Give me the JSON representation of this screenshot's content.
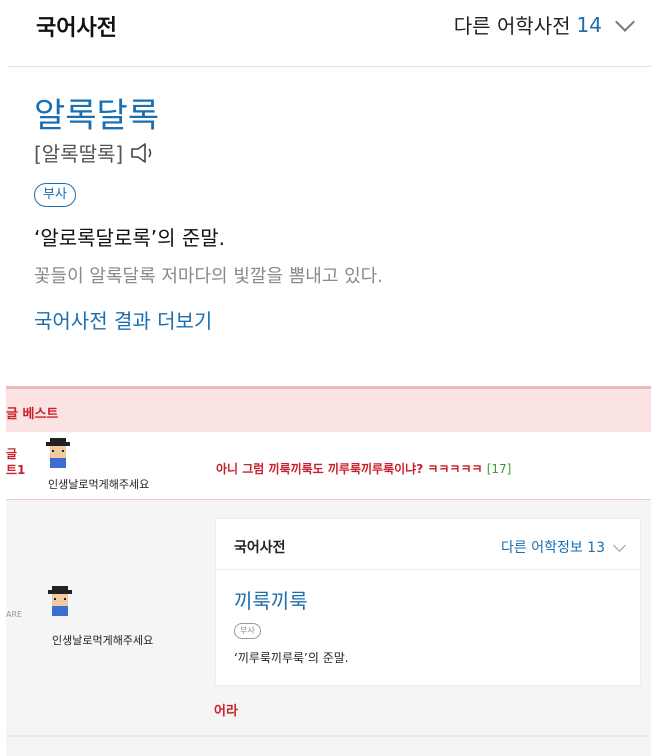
{
  "top": {
    "title": "국어사전",
    "other_label": "다른 어학사전",
    "other_count": "14",
    "headword": "알록달록",
    "pronunciation": "[알록딸록]",
    "pos": "부사",
    "definition": "‘알로록달로록’의 준말.",
    "example": "꽃들이 알록달록 저마다의 빛깔을 뽐내고 있다.",
    "more_link": "국어사전 결과 더보기"
  },
  "lower": {
    "best_label": "글 베스트",
    "row1": {
      "rank": "글\n트1",
      "username": "인생날로먹게해주세요",
      "comment": "아니 그럼 끼룩끼룩도 끼루룩끼루룩이냐? ㅋㅋㅋㅋㅋ ",
      "reply_count": "[17]"
    },
    "row2": {
      "mark": "ARE",
      "username": "인생날로먹게해주세요",
      "card": {
        "title": "국어사전",
        "other": "다른 어학정보 13",
        "headword": "끼룩끼룩",
        "pos": "부사",
        "definition": "‘끼루룩끼루룩’의 준말."
      },
      "bottom_text": "어라"
    }
  },
  "colors": {
    "link_blue": "#1a6fb0",
    "accent_red": "#c9202a",
    "best_bar_pink": "#fbe2e3"
  },
  "icons": {
    "speaker": "speaker-icon",
    "chevron": "chevron-down-icon",
    "avatar": "pixel-avatar-icon"
  }
}
